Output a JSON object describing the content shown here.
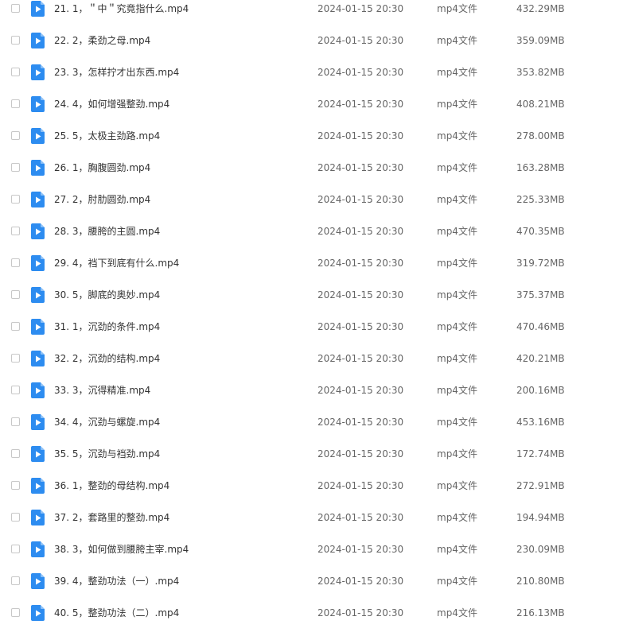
{
  "colors": {
    "icon_blue": "#2d8cf0",
    "text_primary": "#333333",
    "text_secondary": "#666666",
    "checkbox_border": "#c8c8c8"
  },
  "icons": {
    "file": "video-file-icon"
  },
  "files": [
    {
      "name": "21. 1，＂中＂究竟指什么.mp4",
      "date": "2024-01-15 20:30",
      "type": "mp4文件",
      "size": "432.29MB"
    },
    {
      "name": "22. 2，柔劲之母.mp4",
      "date": "2024-01-15 20:30",
      "type": "mp4文件",
      "size": "359.09MB"
    },
    {
      "name": "23. 3，怎样拧才出东西.mp4",
      "date": "2024-01-15 20:30",
      "type": "mp4文件",
      "size": "353.82MB"
    },
    {
      "name": "24. 4，如何增强整劲.mp4",
      "date": "2024-01-15 20:30",
      "type": "mp4文件",
      "size": "408.21MB"
    },
    {
      "name": "25. 5，太极主劲路.mp4",
      "date": "2024-01-15 20:30",
      "type": "mp4文件",
      "size": "278.00MB"
    },
    {
      "name": "26. 1，胸腹圆劲.mp4",
      "date": "2024-01-15 20:30",
      "type": "mp4文件",
      "size": "163.28MB"
    },
    {
      "name": "27. 2，肘肋圆劲.mp4",
      "date": "2024-01-15 20:30",
      "type": "mp4文件",
      "size": "225.33MB"
    },
    {
      "name": "28. 3，腰胯的主圆.mp4",
      "date": "2024-01-15 20:30",
      "type": "mp4文件",
      "size": "470.35MB"
    },
    {
      "name": "29. 4，裆下到底有什么.mp4",
      "date": "2024-01-15 20:30",
      "type": "mp4文件",
      "size": "319.72MB"
    },
    {
      "name": "30. 5，脚底的奥妙.mp4",
      "date": "2024-01-15 20:30",
      "type": "mp4文件",
      "size": "375.37MB"
    },
    {
      "name": "31. 1，沉劲的条件.mp4",
      "date": "2024-01-15 20:30",
      "type": "mp4文件",
      "size": "470.46MB"
    },
    {
      "name": "32. 2，沉劲的结构.mp4",
      "date": "2024-01-15 20:30",
      "type": "mp4文件",
      "size": "420.21MB"
    },
    {
      "name": "33. 3，沉得精准.mp4",
      "date": "2024-01-15 20:30",
      "type": "mp4文件",
      "size": "200.16MB"
    },
    {
      "name": "34. 4，沉劲与螺旋.mp4",
      "date": "2024-01-15 20:30",
      "type": "mp4文件",
      "size": "453.16MB"
    },
    {
      "name": "35. 5，沉劲与裆劲.mp4",
      "date": "2024-01-15 20:30",
      "type": "mp4文件",
      "size": "172.74MB"
    },
    {
      "name": "36. 1，整劲的母结构.mp4",
      "date": "2024-01-15 20:30",
      "type": "mp4文件",
      "size": "272.91MB"
    },
    {
      "name": "37. 2，套路里的整劲.mp4",
      "date": "2024-01-15 20:30",
      "type": "mp4文件",
      "size": "194.94MB"
    },
    {
      "name": "38. 3，如何做到腰胯主宰.mp4",
      "date": "2024-01-15 20:30",
      "type": "mp4文件",
      "size": "230.09MB"
    },
    {
      "name": "39. 4，整劲功法（一）.mp4",
      "date": "2024-01-15 20:30",
      "type": "mp4文件",
      "size": "210.80MB"
    },
    {
      "name": "40. 5，整劲功法（二）.mp4",
      "date": "2024-01-15 20:30",
      "type": "mp4文件",
      "size": "216.13MB"
    }
  ]
}
